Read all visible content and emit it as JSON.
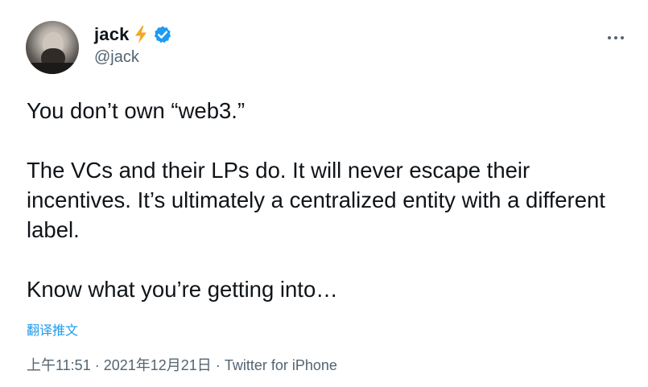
{
  "author": {
    "display_name": "jack",
    "handle": "@jack",
    "badges": [
      "lightning-bolt-emoji",
      "verified-badge-icon"
    ],
    "verified_color": "#1d9bf0",
    "bolt_color": "#f5a623"
  },
  "tweet": {
    "paragraphs": [
      "You don’t own “web3.”",
      "The VCs and their LPs do. It will never escape their incentives. It’s ultimately a centralized entity with a different label.",
      "Know what you’re getting into…"
    ],
    "translate_label": "翻译推文",
    "time": "上午11:51",
    "separator": "·",
    "date": "2021年12月21日",
    "source": "Twitter for iPhone"
  },
  "colors": {
    "text": "#0f1419",
    "secondary": "#536471",
    "link": "#1d9bf0"
  },
  "icons": {
    "more": "more-options-icon"
  }
}
